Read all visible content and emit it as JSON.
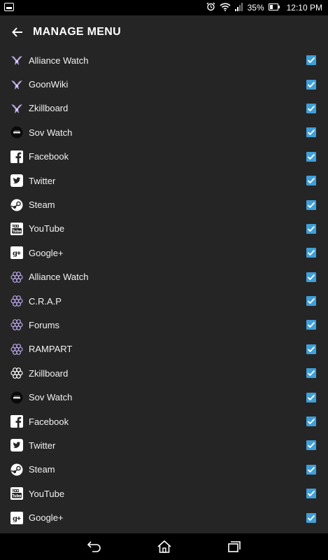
{
  "status_bar": {
    "battery_percent": "35%",
    "time": "12:10 PM"
  },
  "header": {
    "title": "MANAGE MENU"
  },
  "colors": {
    "checkbox": "#3f9fd8",
    "goon_icon": "#b9a6e6",
    "gear_icon": "#b8a6e8"
  },
  "menu_items": [
    {
      "label": "Alliance Watch",
      "icon": "goonswarm-icon",
      "checked": true
    },
    {
      "label": "GoonWiki",
      "icon": "goonswarm-icon",
      "checked": true
    },
    {
      "label": "Zkillboard",
      "icon": "goonswarm-icon",
      "checked": true
    },
    {
      "label": "Sov Watch",
      "icon": "sov-watch-icon",
      "checked": true
    },
    {
      "label": "Facebook",
      "icon": "facebook-icon",
      "checked": true
    },
    {
      "label": "Twitter",
      "icon": "twitter-icon",
      "checked": true
    },
    {
      "label": "Steam",
      "icon": "steam-icon",
      "checked": true
    },
    {
      "label": "YouTube",
      "icon": "youtube-icon",
      "checked": true
    },
    {
      "label": "Google+",
      "icon": "google-plus-icon",
      "checked": true
    },
    {
      "label": "Alliance Watch",
      "icon": "gear-icon",
      "checked": true
    },
    {
      "label": "C.R.A.P",
      "icon": "gear-icon",
      "checked": true
    },
    {
      "label": "Forums",
      "icon": "gear-icon",
      "checked": true
    },
    {
      "label": "RAMPART",
      "icon": "gear-icon",
      "checked": true
    },
    {
      "label": "Zkillboard",
      "icon": "gear-white-icon",
      "checked": true
    },
    {
      "label": "Sov Watch",
      "icon": "sov-watch-icon",
      "checked": true
    },
    {
      "label": "Facebook",
      "icon": "facebook-icon",
      "checked": true
    },
    {
      "label": "Twitter",
      "icon": "twitter-icon",
      "checked": true
    },
    {
      "label": "Steam",
      "icon": "steam-icon",
      "checked": true
    },
    {
      "label": "YouTube",
      "icon": "youtube-icon",
      "checked": true
    },
    {
      "label": "Google+",
      "icon": "google-plus-icon",
      "checked": true
    }
  ]
}
